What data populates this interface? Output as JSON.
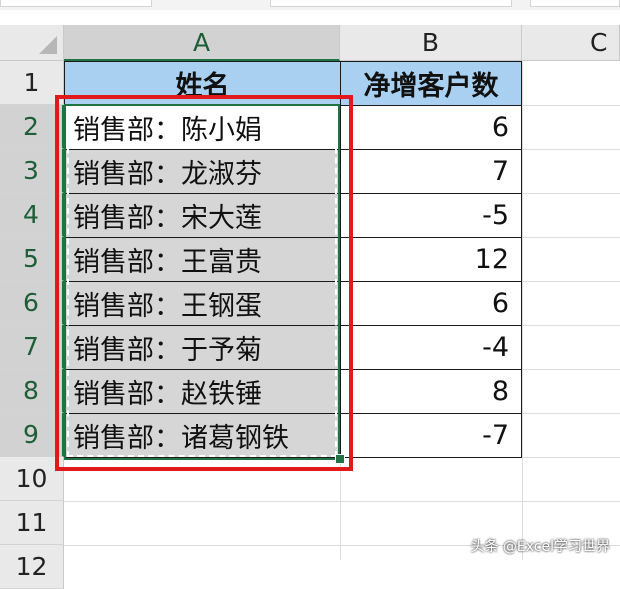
{
  "columns": [
    "A",
    "B",
    "C"
  ],
  "rows": [
    "1",
    "2",
    "3",
    "4",
    "5",
    "6",
    "7",
    "8",
    "9",
    "10",
    "11",
    "12"
  ],
  "header": {
    "name": "姓名",
    "count": "净增客户数"
  },
  "records": [
    {
      "name": "销售部：陈小娟",
      "count": "6"
    },
    {
      "name": "销售部：龙淑芬",
      "count": "7"
    },
    {
      "name": "销售部：宋大莲",
      "count": "-5"
    },
    {
      "name": "销售部：王富贵",
      "count": "12"
    },
    {
      "name": "销售部：王钢蛋",
      "count": "6"
    },
    {
      "name": "销售部：于予菊",
      "count": "-4"
    },
    {
      "name": "销售部：赵铁锤",
      "count": "8"
    },
    {
      "name": "销售部：诸葛钢铁",
      "count": "-7"
    }
  ],
  "watermark": "头条 @Excel学习世界",
  "colors": {
    "header_fill": "#a9d0f0",
    "selection": "#217346",
    "highlight": "#e01a1a",
    "selected_fill": "#d6d6d6"
  }
}
